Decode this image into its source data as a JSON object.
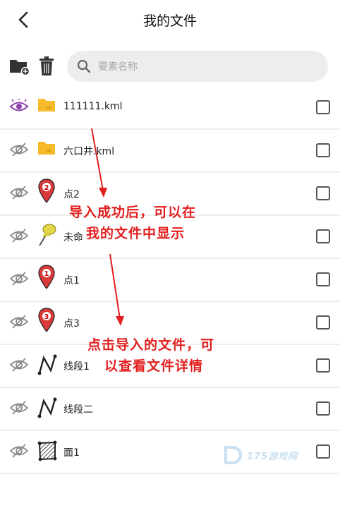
{
  "header": {
    "title": "我的文件"
  },
  "toolbar": {
    "search_placeholder": "要素名称"
  },
  "items": [
    {
      "label": "111111.kml"
    },
    {
      "label": "六口井.kml"
    },
    {
      "label": "点2"
    },
    {
      "label": "未命"
    },
    {
      "label": "点1"
    },
    {
      "label": "点3"
    },
    {
      "label": "线段1"
    },
    {
      "label": "线段二"
    },
    {
      "label": "面1"
    }
  ],
  "annotations": {
    "top_line1": "导入成功后，可以在",
    "top_line2": "我的文件中显示",
    "bottom_line1": "点击导入的文件，可",
    "bottom_line2": "以查看文件详情"
  },
  "watermark": {
    "text": "175游戏网"
  },
  "colors": {
    "folder": "#f5b92a",
    "marker": "#d93a3a",
    "pin": "#e2d84a",
    "annotation": "#e21f1f",
    "eye_active": "#8e44ad",
    "eye_inactive": "#8a8a8a"
  }
}
